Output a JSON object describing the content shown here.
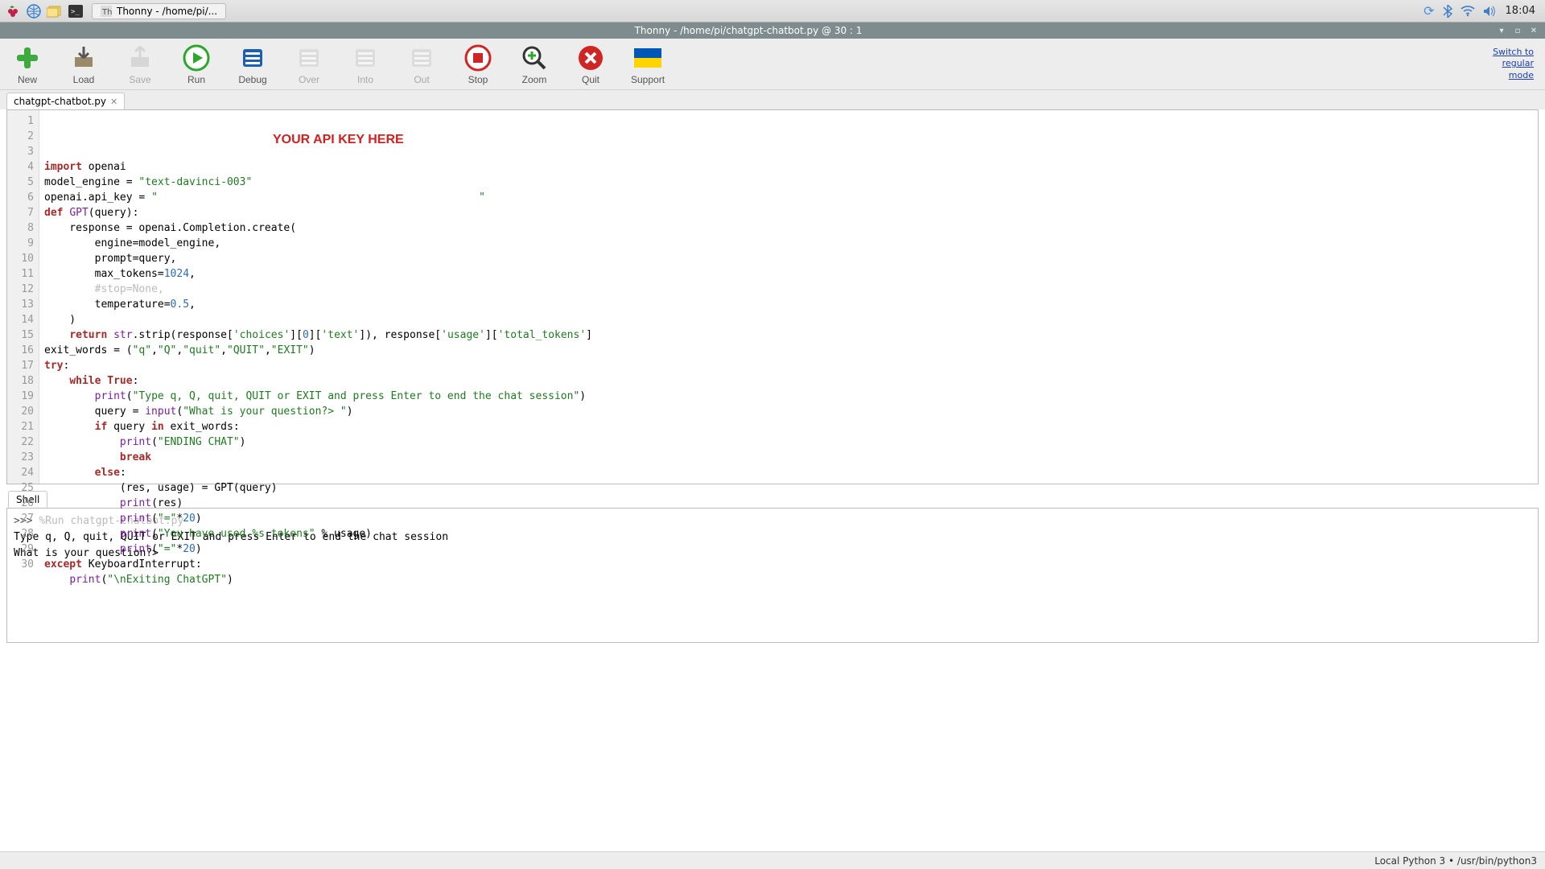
{
  "os": {
    "task_tab": "Thonny  -  /home/pi/...",
    "clock": "18:04"
  },
  "window": {
    "title": "Thonny  -  /home/pi/chatgpt-chatbot.py  @  30 : 1"
  },
  "toolbar": {
    "new": "New",
    "load": "Load",
    "save": "Save",
    "run": "Run",
    "debug": "Debug",
    "over": "Over",
    "into": "Into",
    "out": "Out",
    "stop": "Stop",
    "zoom": "Zoom",
    "quit": "Quit",
    "support": "Support",
    "switch_link": "Switch to\nregular\nmode"
  },
  "tabs": {
    "file": "chatgpt-chatbot.py"
  },
  "editor": {
    "line_count": 30,
    "api_overlay": "YOUR API KEY HERE",
    "lines": [
      {
        "n": 1,
        "tokens": [
          [
            "kw",
            "import"
          ],
          [
            "",
            " openai"
          ]
        ]
      },
      {
        "n": 2,
        "tokens": [
          [
            "",
            "model_engine = "
          ],
          [
            "str",
            "\"text-davinci-003\""
          ]
        ]
      },
      {
        "n": 3,
        "tokens": [
          [
            "",
            "openai.api_key = "
          ],
          [
            "str",
            "\""
          ],
          [
            "",
            "                                                   "
          ],
          [
            "str",
            "\""
          ]
        ]
      },
      {
        "n": 4,
        "tokens": [
          [
            "kw",
            "def"
          ],
          [
            "",
            " "
          ],
          [
            "builtin",
            "GPT"
          ],
          [
            "",
            "(query):"
          ]
        ]
      },
      {
        "n": 5,
        "tokens": [
          [
            "",
            "    response = openai.Completion.create("
          ]
        ]
      },
      {
        "n": 6,
        "tokens": [
          [
            "",
            "        engine=model_engine,"
          ]
        ]
      },
      {
        "n": 7,
        "tokens": [
          [
            "",
            "        prompt=query,"
          ]
        ]
      },
      {
        "n": 8,
        "tokens": [
          [
            "",
            "        max_tokens="
          ],
          [
            "num",
            "1024"
          ],
          [
            "",
            ","
          ]
        ]
      },
      {
        "n": 9,
        "tokens": [
          [
            "",
            "        "
          ],
          [
            "cmt",
            "#stop=None,"
          ]
        ]
      },
      {
        "n": 10,
        "tokens": [
          [
            "",
            "        temperature="
          ],
          [
            "num",
            "0.5"
          ],
          [
            "",
            ","
          ]
        ]
      },
      {
        "n": 11,
        "tokens": [
          [
            "",
            "    )"
          ]
        ]
      },
      {
        "n": 12,
        "tokens": [
          [
            "",
            "    "
          ],
          [
            "kw",
            "return"
          ],
          [
            "",
            " "
          ],
          [
            "builtin",
            "str"
          ],
          [
            "",
            ".strip(response["
          ],
          [
            "str",
            "'choices'"
          ],
          [
            "",
            "]["
          ],
          [
            "num",
            "0"
          ],
          [
            "",
            "]["
          ],
          [
            "str",
            "'text'"
          ],
          [
            "",
            "]), response["
          ],
          [
            "str",
            "'usage'"
          ],
          [
            "",
            "]["
          ],
          [
            "str",
            "'total_tokens'"
          ],
          [
            "",
            "]"
          ]
        ]
      },
      {
        "n": 13,
        "tokens": [
          [
            "",
            ""
          ]
        ]
      },
      {
        "n": 14,
        "tokens": [
          [
            "",
            "exit_words = ("
          ],
          [
            "str",
            "\"q\""
          ],
          [
            "",
            ","
          ],
          [
            "str",
            "\"Q\""
          ],
          [
            "",
            ","
          ],
          [
            "str",
            "\"quit\""
          ],
          [
            "",
            ","
          ],
          [
            "str",
            "\"QUIT\""
          ],
          [
            "",
            ","
          ],
          [
            "str",
            "\"EXIT\""
          ],
          [
            "",
            ")"
          ]
        ]
      },
      {
        "n": 15,
        "tokens": [
          [
            "kw",
            "try"
          ],
          [
            "",
            ":"
          ]
        ]
      },
      {
        "n": 16,
        "tokens": [
          [
            "",
            "    "
          ],
          [
            "kw",
            "while"
          ],
          [
            "",
            " "
          ],
          [
            "kw",
            "True"
          ],
          [
            "",
            ":"
          ]
        ]
      },
      {
        "n": 17,
        "tokens": [
          [
            "",
            "        "
          ],
          [
            "builtin",
            "print"
          ],
          [
            "",
            "("
          ],
          [
            "str",
            "\"Type q, Q, quit, QUIT or EXIT and press Enter to end the chat session\""
          ],
          [
            "",
            ")"
          ]
        ]
      },
      {
        "n": 18,
        "tokens": [
          [
            "",
            "        query = "
          ],
          [
            "builtin",
            "input"
          ],
          [
            "",
            "("
          ],
          [
            "str",
            "\"What is your question?> \""
          ],
          [
            "",
            ")"
          ]
        ]
      },
      {
        "n": 19,
        "tokens": [
          [
            "",
            "        "
          ],
          [
            "kw",
            "if"
          ],
          [
            "",
            " query "
          ],
          [
            "kw",
            "in"
          ],
          [
            "",
            " exit_words:"
          ]
        ]
      },
      {
        "n": 20,
        "tokens": [
          [
            "",
            "            "
          ],
          [
            "builtin",
            "print"
          ],
          [
            "",
            "("
          ],
          [
            "str",
            "\"ENDING CHAT\""
          ],
          [
            "",
            ")"
          ]
        ]
      },
      {
        "n": 21,
        "tokens": [
          [
            "",
            "            "
          ],
          [
            "kw",
            "break"
          ]
        ]
      },
      {
        "n": 22,
        "tokens": [
          [
            "",
            "        "
          ],
          [
            "kw",
            "else"
          ],
          [
            "",
            ":"
          ]
        ]
      },
      {
        "n": 23,
        "tokens": [
          [
            "",
            "            (res, usage) = GPT(query)"
          ]
        ]
      },
      {
        "n": 24,
        "tokens": [
          [
            "",
            "            "
          ],
          [
            "builtin",
            "print"
          ],
          [
            "",
            "(res)"
          ]
        ]
      },
      {
        "n": 25,
        "tokens": [
          [
            "",
            "            "
          ],
          [
            "builtin",
            "print"
          ],
          [
            "",
            "("
          ],
          [
            "str",
            "\"=\""
          ],
          [
            "",
            "*"
          ],
          [
            "num",
            "20"
          ],
          [
            "",
            ")"
          ]
        ]
      },
      {
        "n": 26,
        "tokens": [
          [
            "",
            "            "
          ],
          [
            "builtin",
            "print"
          ],
          [
            "",
            "("
          ],
          [
            "str",
            "\"You have used %s tokens\""
          ],
          [
            "",
            " % usage)"
          ]
        ]
      },
      {
        "n": 27,
        "tokens": [
          [
            "",
            "            "
          ],
          [
            "builtin",
            "print"
          ],
          [
            "",
            "("
          ],
          [
            "str",
            "\"=\""
          ],
          [
            "",
            "*"
          ],
          [
            "num",
            "20"
          ],
          [
            "",
            ")"
          ]
        ]
      },
      {
        "n": 28,
        "tokens": [
          [
            "kw",
            "except"
          ],
          [
            "",
            " KeyboardInterrupt:"
          ]
        ]
      },
      {
        "n": 29,
        "tokens": [
          [
            "",
            "    "
          ],
          [
            "builtin",
            "print"
          ],
          [
            "",
            "("
          ],
          [
            "str",
            "\"\\nExiting ChatGPT\""
          ],
          [
            "",
            ")"
          ]
        ]
      },
      {
        "n": 30,
        "tokens": [
          [
            "",
            ""
          ]
        ]
      }
    ]
  },
  "shell": {
    "label": "Shell",
    "prompt": ">>> ",
    "run_cmd": "%Run chatgpt-chatbot.py",
    "line1": " Type q, Q, quit, QUIT or EXIT and press Enter to end the chat session",
    "line2": " What is your question?> "
  },
  "status": {
    "interpreter": "Local Python 3  •  /usr/bin/python3"
  }
}
